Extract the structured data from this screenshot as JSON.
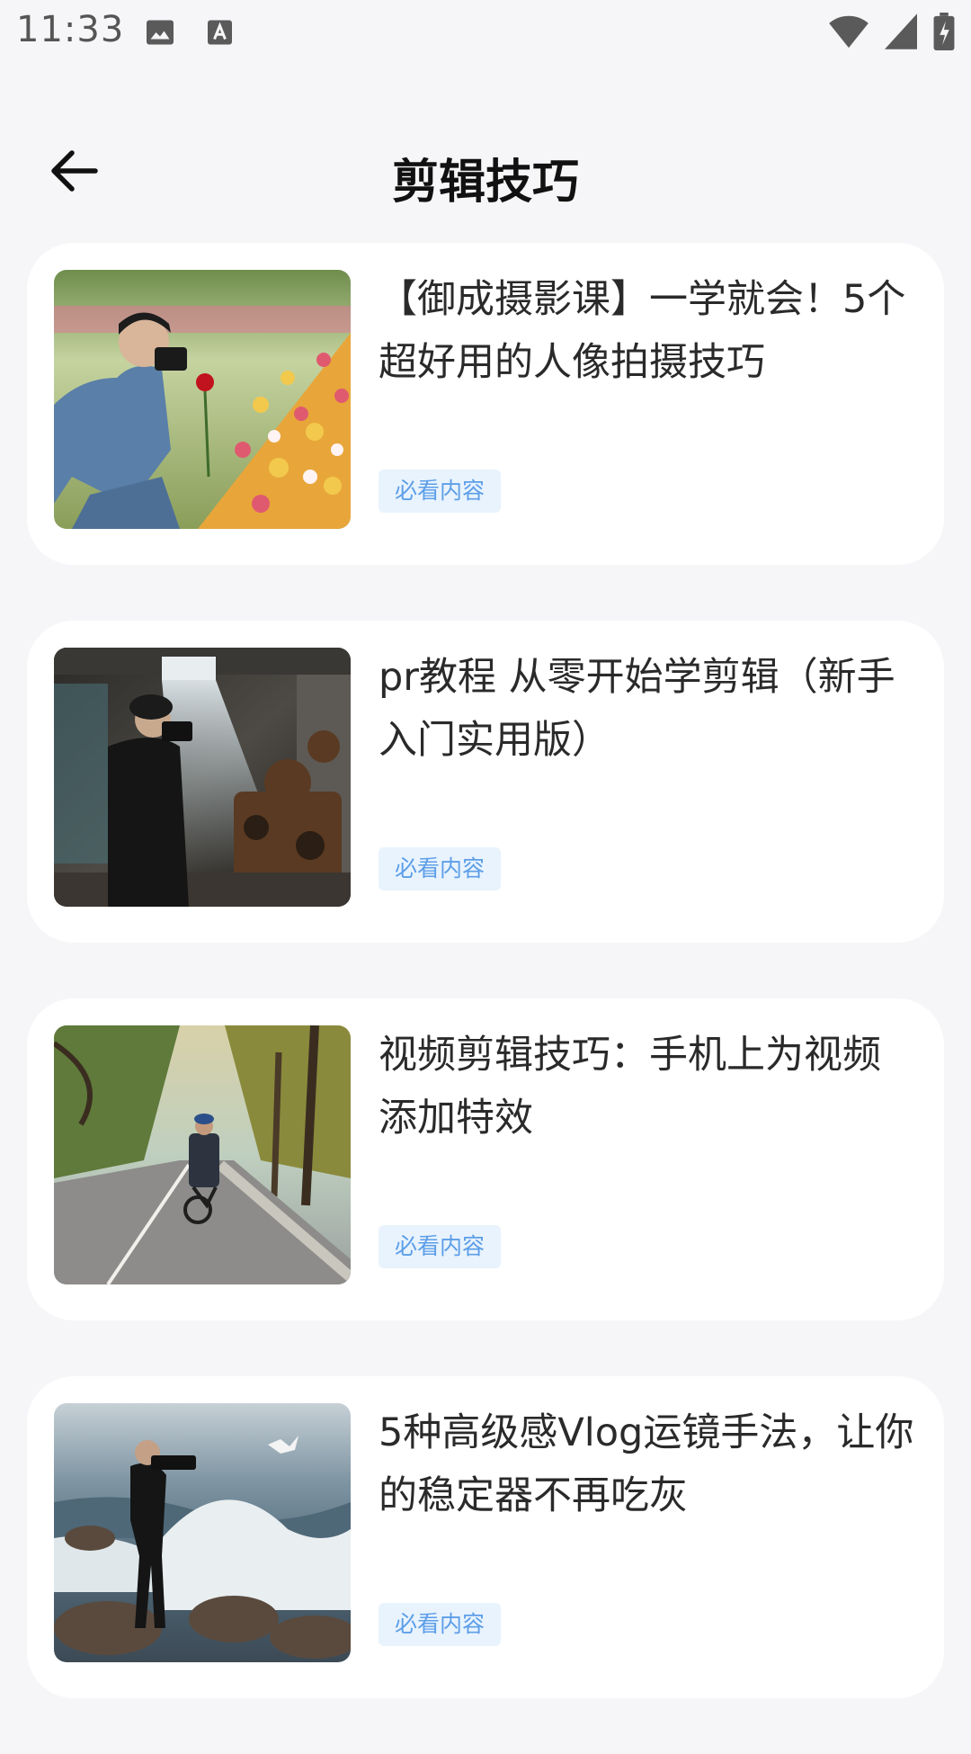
{
  "status_bar": {
    "time": "11:33",
    "icons": [
      "image-icon",
      "font-icon",
      "wifi-icon",
      "signal-icon",
      "battery-icon"
    ]
  },
  "header": {
    "back_icon": "arrow-left-icon",
    "title": "剪辑技巧"
  },
  "articles": [
    {
      "title": "【御成摄影课】一学就会！5个超好用的人像拍摄技巧",
      "tag": "必看内容",
      "thumbnail": "photographer-in-flower-field"
    },
    {
      "title": "pr教程 从零开始学剪辑（新手入门实用版）",
      "tag": "必看内容",
      "thumbnail": "photographer-in-abandoned-factory"
    },
    {
      "title": "视频剪辑技巧：手机上为视频添加特效",
      "tag": "必看内容",
      "thumbnail": "cyclist-on-tree-lined-road"
    },
    {
      "title": "5种高级感Vlog运镜手法，让你的稳定器不再吃灰",
      "tag": "必看内容",
      "thumbnail": "photographer-on-seaside-rocks"
    }
  ],
  "colors": {
    "background": "#f6f6f8",
    "card": "#ffffff",
    "tag_text": "#5d9ee8",
    "tag_bg": "#e8f3fd"
  }
}
